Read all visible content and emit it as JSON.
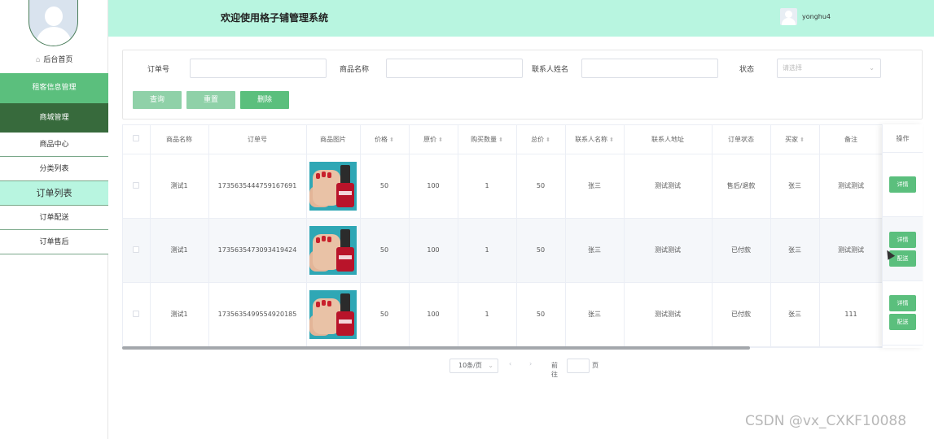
{
  "sidebar": {
    "home_label": "后台首页",
    "items": [
      {
        "label": "租客信息管理"
      },
      {
        "label": "商城管理"
      },
      {
        "label": "商品中心"
      },
      {
        "label": "分类列表"
      },
      {
        "label": "订单列表"
      },
      {
        "label": "订单配送"
      },
      {
        "label": "订单售后"
      }
    ]
  },
  "header": {
    "title": "欢迎使用格子铺管理系统",
    "username": "yonghu4"
  },
  "search": {
    "order_no_label": "订单号",
    "product_name_label": "商品名称",
    "contact_name_label": "联系人姓名",
    "status_label": "状态",
    "status_placeholder": "请选择",
    "query_button": "查询",
    "reset_button": "重置",
    "delete_button": "删除"
  },
  "table": {
    "columns": [
      "商品名称",
      "订单号",
      "商品图片",
      "价格",
      "原价",
      "购买数量",
      "总价",
      "联系人名称",
      "联系人地址",
      "订单状态",
      "买家",
      "备注",
      "操作"
    ],
    "rows": [
      {
        "name": "测试1",
        "order_no": "1735635444759167691",
        "price": "50",
        "original_price": "100",
        "quantity": "1",
        "total": "50",
        "contact": "张三",
        "address": "测试测试",
        "status": "售后/退款",
        "buyer": "张三",
        "remark": "测试测试",
        "actions": [
          "详情"
        ]
      },
      {
        "name": "测试1",
        "order_no": "1735635473093419424",
        "price": "50",
        "original_price": "100",
        "quantity": "1",
        "total": "50",
        "contact": "张三",
        "address": "测试测试",
        "status": "已付款",
        "buyer": "张三",
        "remark": "测试测试",
        "actions": [
          "详情",
          "配送"
        ]
      },
      {
        "name": "测试1",
        "order_no": "1735635499554920185",
        "price": "50",
        "original_price": "100",
        "quantity": "1",
        "total": "50",
        "contact": "张三",
        "address": "测试测试",
        "status": "已付款",
        "buyer": "张三",
        "remark": "111",
        "actions": [
          "详情",
          "配送"
        ]
      }
    ]
  },
  "pagination": {
    "page_size": "10条/页",
    "goto_label": "前往",
    "page_suffix": "页"
  },
  "watermark": "CSDN @vx_CXKF10088"
}
